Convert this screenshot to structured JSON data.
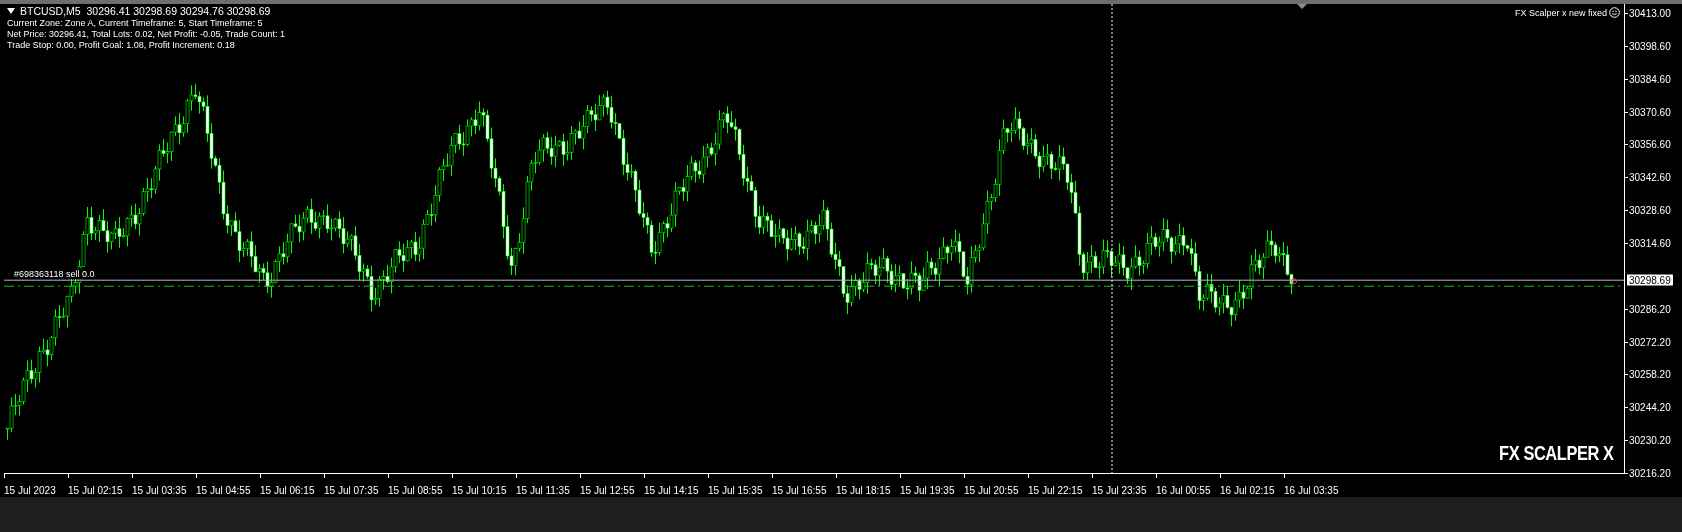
{
  "chart": {
    "symbol": "BTCUSD,M5",
    "ohlc": "30296.41 30298.69 30294.76 30298.69",
    "info_lines": [
      "Current Zone: Zone A, Current Timeframe: 5, Start Timeframe: 5",
      "Net Price: 30296.41, Total Lots: 0.02, Net Profit: -0.05, Trade Count: 1",
      "Trade Stop: 0.00, Profit Goal: 1.08, Profit Increment: 0.18"
    ],
    "expert_name": "FX Scalper x new fixed",
    "brand": "FX SCALPER X",
    "order_label": "#698363118 sell 0.0",
    "current_price": "30298.69",
    "price_axis": [
      "30413.00",
      "30398.60",
      "30384.60",
      "30370.60",
      "30356.60",
      "30342.60",
      "30328.60",
      "30314.60",
      "30286.20",
      "30272.20",
      "30258.20",
      "30244.20",
      "30230.20",
      "30216.20"
    ],
    "time_axis": [
      "15 Jul 2023",
      "15 Jul 02:15",
      "15 Jul 03:35",
      "15 Jul 04:55",
      "15 Jul 06:15",
      "15 Jul 07:35",
      "15 Jul 08:55",
      "15 Jul 10:15",
      "15 Jul 11:35",
      "15 Jul 12:55",
      "15 Jul 14:15",
      "15 Jul 15:35",
      "15 Jul 16:55",
      "15 Jul 18:15",
      "15 Jul 19:35",
      "15 Jul 20:55",
      "15 Jul 22:15",
      "15 Jul 23:35",
      "16 Jul 00:55",
      "16 Jul 02:15",
      "16 Jul 03:35"
    ]
  }
}
